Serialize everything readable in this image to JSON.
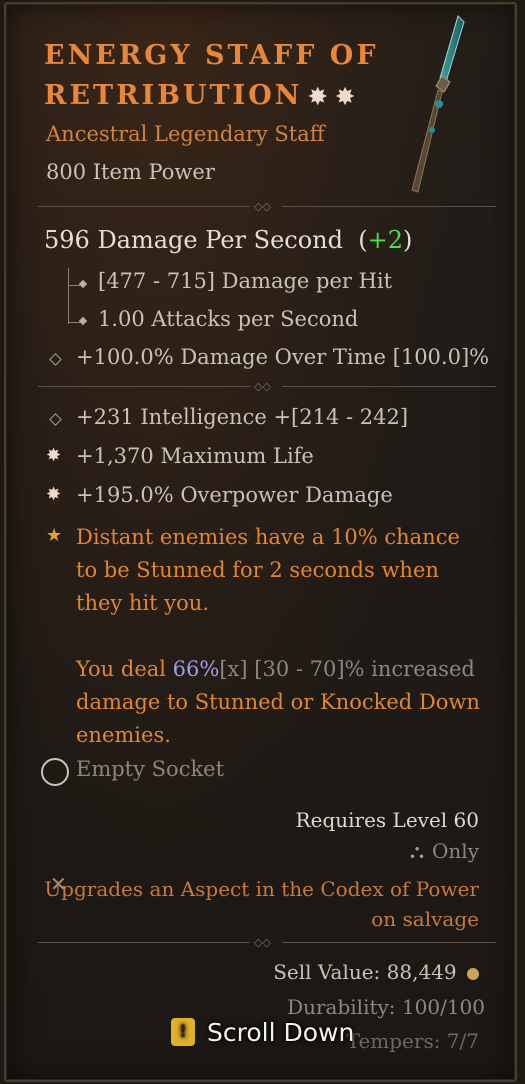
{
  "item": {
    "name": "ENERGY STAFF OF RETRIBUTION",
    "rarity_line": "Ancestral Legendary Staff",
    "item_power": "800 Item Power"
  },
  "stats": {
    "dps_value": "596 Damage Per Second",
    "dps_delta": "+2",
    "damage_per_hit": "[477 - 715] Damage per Hit",
    "attacks_per_second": "1.00 Attacks per Second",
    "implicit": "+100.0% Damage Over Time [100.0]%",
    "intelligence": "+231 Intelligence +[214 - 242]",
    "max_life": "+1,370 Maximum Life",
    "overpower": "+195.0% Overpower Damage"
  },
  "aspect": {
    "line1": "Distant enemies have a 10% chance",
    "line2": "to be Stunned for 2 seconds when",
    "line3": "they hit you.",
    "line4_prefix": "You deal ",
    "line4_value": "66%",
    "line4_x": "[x]",
    "line4_suffix": " [30 - 70]% increased",
    "line5": "damage to Stunned or Knocked Down",
    "line6": "enemies."
  },
  "socket": {
    "label": "Empty Socket"
  },
  "requirements": {
    "level": "Requires Level 60",
    "class_only": "Only",
    "codex_line1": "Upgrades an Aspect in the Codex of Power",
    "codex_line2": "on salvage"
  },
  "footer": {
    "sell_value": "Sell Value: 88,449",
    "durability": "Durability: 100/100",
    "tempers": "Tempers: 7/7",
    "scroll_key": "!",
    "scroll_label": "Scroll Down"
  },
  "colors": {
    "legendary_orange": "#e8863a",
    "positive_green": "#4be04b",
    "roll_value_blue": "#9f9fe6"
  }
}
